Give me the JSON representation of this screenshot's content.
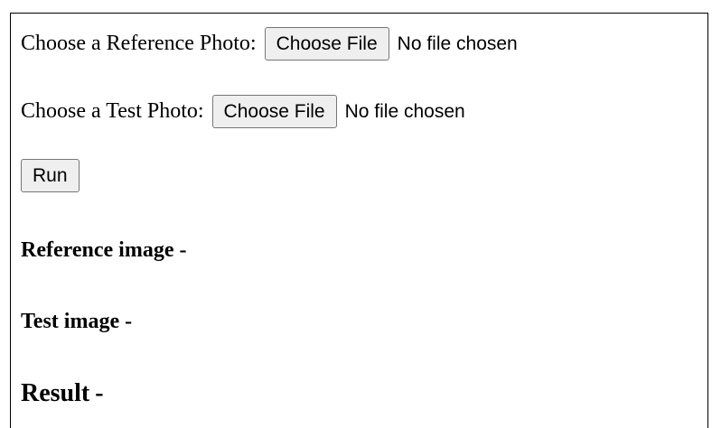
{
  "reference": {
    "label": "Choose a Reference Photo:",
    "button_label": "Choose File",
    "status": "No file chosen"
  },
  "test": {
    "label": "Choose a Test Photo:",
    "button_label": "Choose File",
    "status": "No file chosen"
  },
  "run": {
    "label": "Run"
  },
  "outputs": {
    "reference_heading": "Reference image",
    "test_heading": "Test image",
    "result_heading": "Result",
    "separator": "-"
  }
}
